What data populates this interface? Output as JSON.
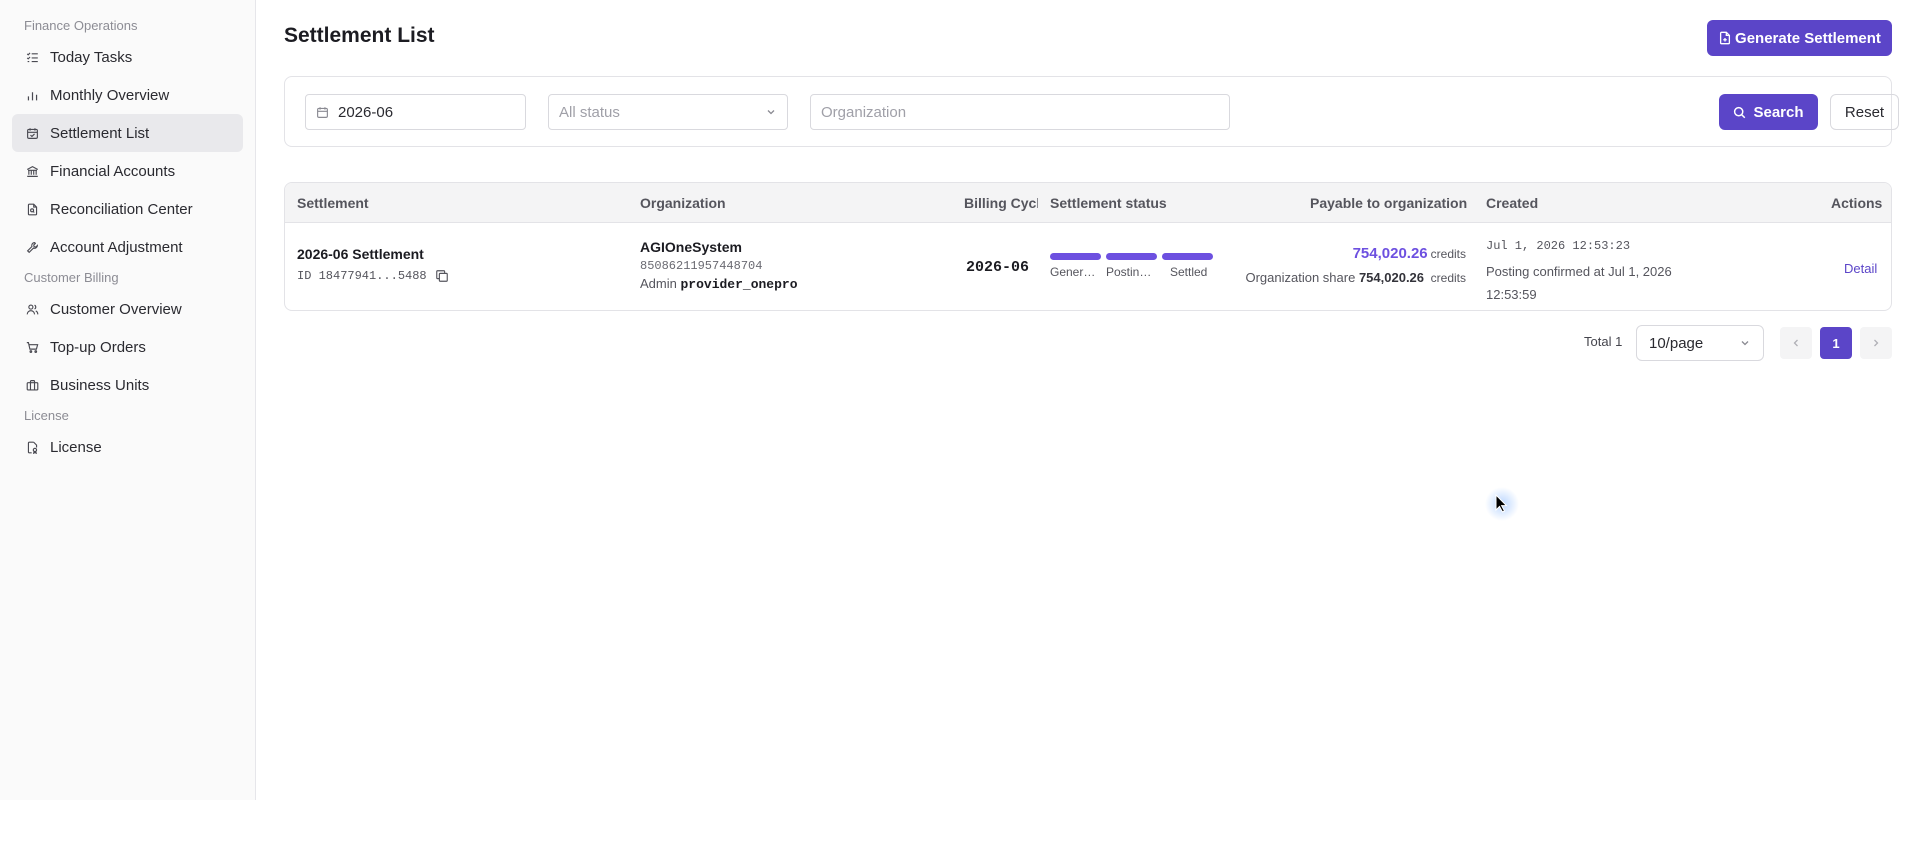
{
  "sidebar": {
    "groups": [
      {
        "label": "Finance Operations",
        "items": [
          {
            "label": "Today Tasks",
            "icon": "list-check-icon",
            "active": false
          },
          {
            "label": "Monthly Overview",
            "icon": "bar-chart-icon",
            "active": false
          },
          {
            "label": "Settlement List",
            "icon": "calendar-check-icon",
            "active": true
          },
          {
            "label": "Financial Accounts",
            "icon": "bank-icon",
            "active": false
          },
          {
            "label": "Reconciliation Center",
            "icon": "file-search-icon",
            "active": false
          },
          {
            "label": "Account Adjustment",
            "icon": "wrench-icon",
            "active": false
          }
        ]
      },
      {
        "label": "Customer Billing",
        "items": [
          {
            "label": "Customer Overview",
            "icon": "users-icon",
            "active": false
          },
          {
            "label": "Top-up Orders",
            "icon": "cart-icon",
            "active": false
          },
          {
            "label": "Business Units",
            "icon": "briefcase-icon",
            "active": false
          }
        ]
      },
      {
        "label": "License",
        "items": [
          {
            "label": "License",
            "icon": "license-icon",
            "active": false
          }
        ]
      }
    ]
  },
  "header": {
    "title": "Settlement List",
    "generate_label": "Generate Settlement"
  },
  "filters": {
    "month_value": "2026-06",
    "status_placeholder": "All status",
    "org_placeholder": "Organization",
    "search_label": "Search",
    "reset_label": "Reset"
  },
  "table": {
    "columns": {
      "settlement": "Settlement",
      "organization": "Organization",
      "billing_cycle": "Billing Cycle",
      "status": "Settlement status",
      "payable": "Payable to organization",
      "created": "Created",
      "actions": "Actions"
    },
    "rows": [
      {
        "name": "2026-06 Settlement",
        "id": "ID 18477941...5488",
        "org_name": "AGIOneSystem",
        "org_code": "85086211957448704",
        "admin_label": "Admin",
        "admin_value": "provider_onepro",
        "billing_cycle": "2026-06",
        "status_steps": [
          "Generated",
          "Posting confirmed",
          "Settled"
        ],
        "payable_amount": "754,020.26",
        "payable_unit": "credits",
        "share_label": "Organization share",
        "share_amount": "754,020.26",
        "share_unit": "credits",
        "created_ts": "Jul 1, 2026 12:53:23",
        "created_note": "Posting confirmed at Jul 1, 2026 12:53:59",
        "action_label": "Detail"
      }
    ]
  },
  "pagination": {
    "total_label": "Total 1",
    "page_size": "10/page",
    "current_page": "1"
  },
  "colors": {
    "accent": "#5b45c8",
    "progress": "#6d50e0"
  }
}
